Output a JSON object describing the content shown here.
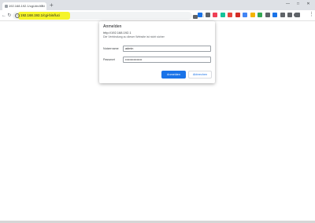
{
  "tab": {
    "title": "192.168.192.1/cgi-bin/luci",
    "close": "×",
    "new_tab": "+"
  },
  "window": {
    "minimize": "—",
    "maximize": "□",
    "close": "✕"
  },
  "toolbar": {
    "back": "←",
    "forward": "→",
    "reload": "↻",
    "info": "i",
    "star": "☆",
    "menu": "⋮"
  },
  "address": {
    "url": "192.168.192.1/cgi-bin/luci",
    "highlight_color": "#f4f31d"
  },
  "extensions": [
    {
      "icon": "gear-ext-icon",
      "color": "#1a73e8"
    },
    {
      "icon": "shield-ext-icon",
      "color": "#5f6368"
    },
    {
      "icon": "pocket-ext-icon",
      "color": "#ef4056"
    },
    {
      "icon": "grammar-ext-icon",
      "color": "#15c39a"
    },
    {
      "icon": "adblock-ext-icon",
      "color": "#e8453c"
    },
    {
      "icon": "lastpass-ext-icon",
      "color": "#d32d27"
    },
    {
      "icon": "translate-ext-icon",
      "color": "#4285f4"
    },
    {
      "icon": "tag-ext-icon",
      "color": "#f4b400"
    },
    {
      "icon": "circle-ext-icon",
      "color": "#34a853"
    },
    {
      "icon": "box-ext-icon",
      "color": "#5f6368"
    },
    {
      "icon": "badge-ext-icon",
      "color": "#1a73e8"
    },
    {
      "icon": "grid-ext-icon",
      "color": "#5f6368"
    },
    {
      "icon": "bookmark-ext-icon",
      "color": "#5f6368"
    },
    {
      "icon": "puzzle-ext-icon",
      "color": "#5f6368"
    }
  ],
  "dialog": {
    "title": "Anmelden",
    "url": "http://192.168.192.1",
    "note": "Die Verbindung zu dieser Website ist nicht sicher",
    "username_label": "Nutzername",
    "username_value": "admin",
    "password_label": "Passwort",
    "password_value": "••••••••••••••••",
    "login_button": "Anmelden",
    "cancel_button": "Abbrechen"
  }
}
